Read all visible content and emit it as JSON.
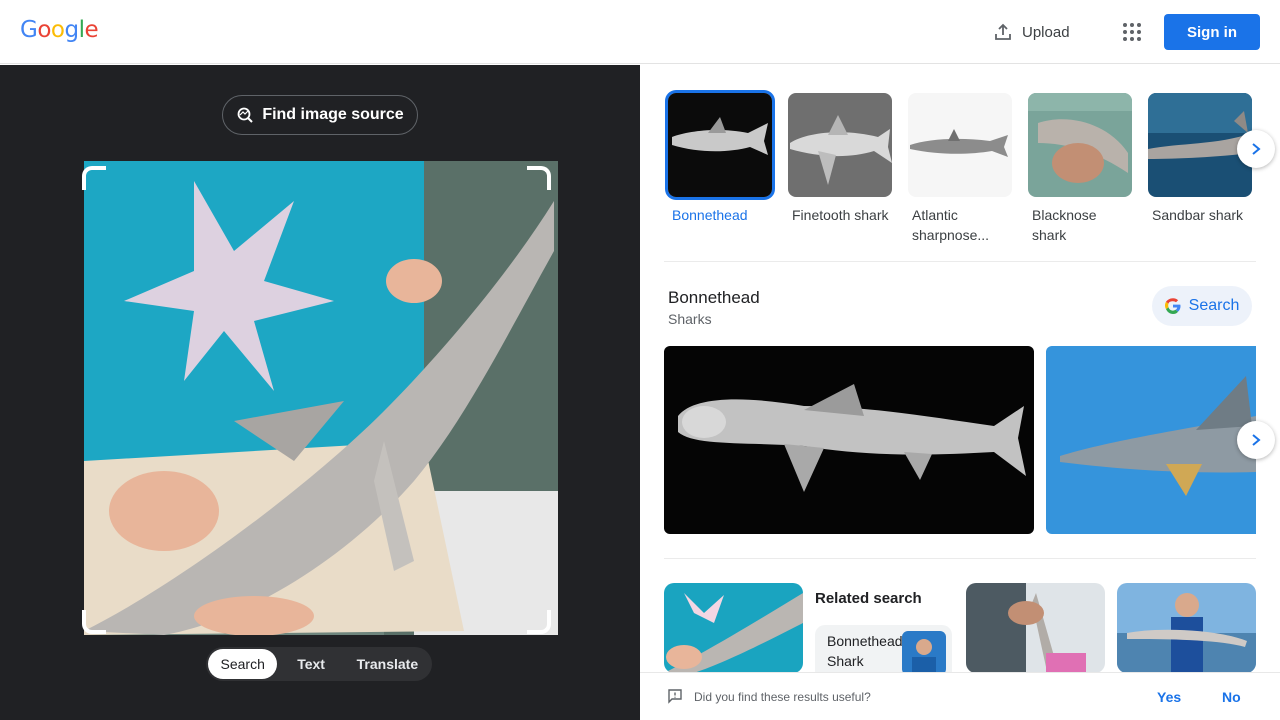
{
  "header": {
    "logo_letters": [
      {
        "ch": "G",
        "color": "#4285f4"
      },
      {
        "ch": "o",
        "color": "#ea4335"
      },
      {
        "ch": "o",
        "color": "#fbbc05"
      },
      {
        "ch": "g",
        "color": "#4285f4"
      },
      {
        "ch": "l",
        "color": "#34a853"
      },
      {
        "ch": "e",
        "color": "#ea4335"
      }
    ],
    "upload_label": "Upload",
    "upload_icon": "upload-icon",
    "apps_icon": "apps-grid-icon",
    "signin_label": "Sign in"
  },
  "left_panel": {
    "find_source_label": "Find image source",
    "image_description_icon": "image-search-icon",
    "modes": [
      {
        "label": "Search",
        "active": true
      },
      {
        "label": "Text",
        "active": false
      },
      {
        "label": "Translate",
        "active": false
      }
    ]
  },
  "right_panel": {
    "entities": [
      {
        "label": "Bonnethead",
        "selected": true
      },
      {
        "label": "Finetooth shark",
        "selected": false
      },
      {
        "label": "Atlantic sharpnose...",
        "selected": false
      },
      {
        "label": "Blacknose shark",
        "selected": false
      },
      {
        "label": "Sandbar shark",
        "selected": false
      }
    ],
    "entity_title": "Bonnethead",
    "entity_subtitle": "Sharks",
    "search_button_label": "Search",
    "related_title": "Related search",
    "related_chip_label": "Bonnethead Shark"
  },
  "feedback": {
    "question": "Did you find these results useful?",
    "yes_label": "Yes",
    "no_label": "No"
  },
  "colors": {
    "accent": "#1a73e8",
    "dark_panel": "#202124"
  }
}
